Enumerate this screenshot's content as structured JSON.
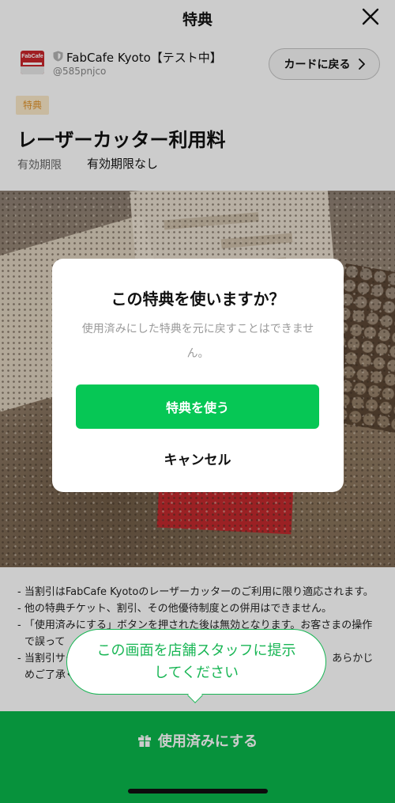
{
  "header": {
    "title": "特典"
  },
  "shop": {
    "logo_text": "FabCafe",
    "name": "FabCafe Kyoto【テスト中】",
    "id": "@585pnjco",
    "back_button": "カードに戻る"
  },
  "coupon": {
    "tag": "特典",
    "title": "レーザーカッター利用料",
    "expiry_label": "有効期限",
    "expiry_value": "有効期限なし"
  },
  "notes": [
    "- 当割引はFabCafe Kyotoのレーザーカッターのご利用に限り適応されます。",
    "- 他の特典チケット、割引、その他優待制度との併用はできません。",
    "- 「使用済みにする」ボタンを押された後は無効となります。お客さまの操作で誤って",
    "- 当割引サービスは予告なく変更・終了する場合がございますので、あらかじめご了承ください。"
  ],
  "tooltip": {
    "line1": "この画面を店舗スタッフに提示",
    "line2": "してください"
  },
  "bottom": {
    "use_button": "使用済みにする"
  },
  "dialog": {
    "title": "この特典を使いますか？",
    "message": "使用済みにした特典を元に戻すことはできません。",
    "confirm": "特典を使う",
    "cancel": "キャンセル"
  },
  "colors": {
    "primary_green": "#06c755",
    "bar_green": "#09b74b",
    "brand_red": "#c8262b",
    "tag_bg": "#fbe9c8",
    "tag_text": "#e0942e"
  }
}
